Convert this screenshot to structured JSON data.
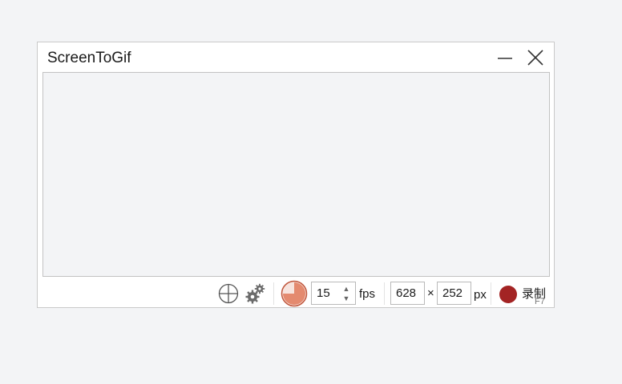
{
  "window": {
    "title": "ScreenToGif",
    "minimize_icon": "minimize-icon",
    "close_icon": "close-icon"
  },
  "toolbar": {
    "snap_icon": "crosshair-icon",
    "options_icon": "gears-icon",
    "frame_delay_icon": "pie-timer-icon",
    "fps_value": "15",
    "fps_label": "fps",
    "width_value": "628",
    "times_sign": "×",
    "height_value": "252",
    "px_label": "px",
    "record_label": "录制",
    "record_shortcut": "F7"
  },
  "colors": {
    "record_dot": "#a32424",
    "pie_fill": "#e48a6f",
    "pie_border": "#c0563c"
  }
}
